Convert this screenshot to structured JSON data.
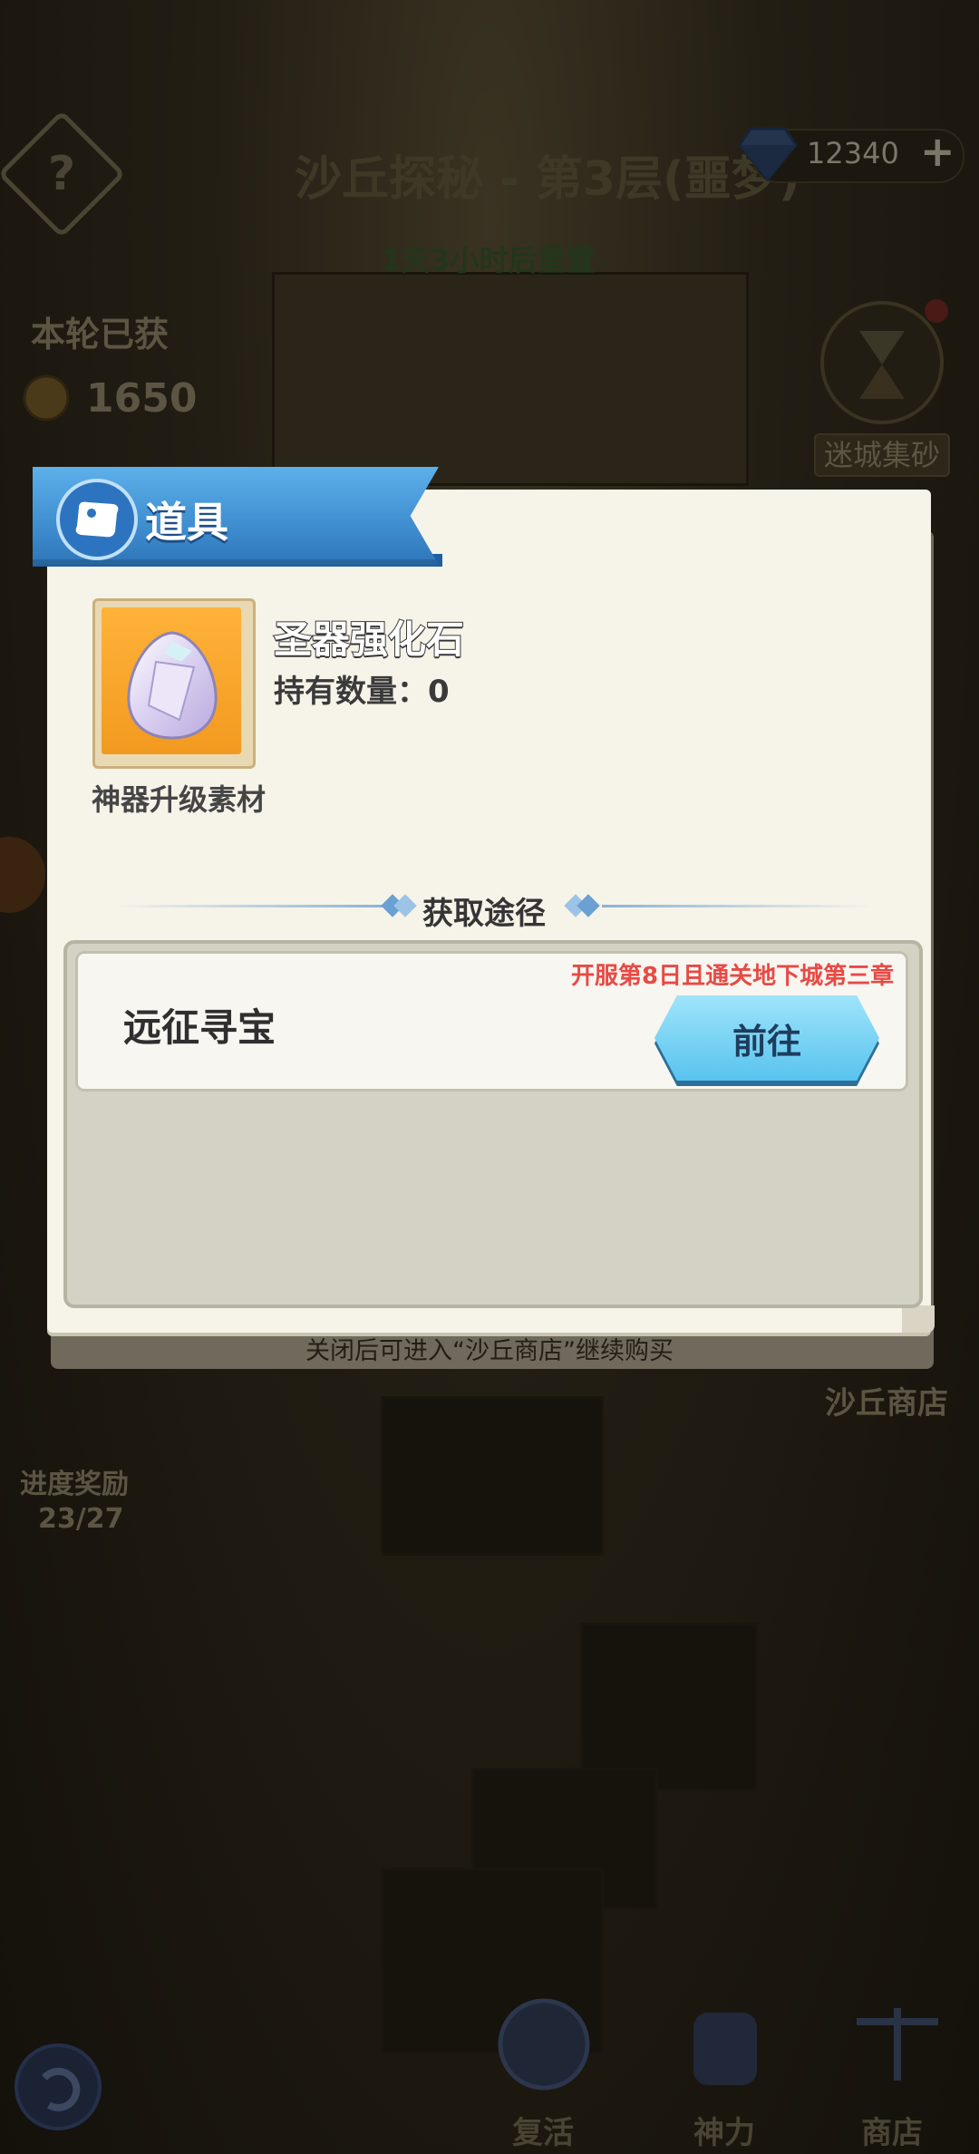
{
  "background": {
    "title": "沙丘探秘 - 第3层(噩梦)",
    "subtitle": "1天3小时后重置",
    "round_label": "本轮已获",
    "round_value": "1650",
    "gem_count": "12340",
    "gem_plus": "+",
    "help_symbol": "?",
    "maze_button": "迷城集砂",
    "shop_label": "沙丘商店",
    "progress_label": "进度奖励",
    "progress_value": "23/27",
    "nav": {
      "revive": "复活",
      "power": "神力",
      "shop": "商店"
    }
  },
  "modal": {
    "title": "道具",
    "item": {
      "name": "圣器强化石",
      "quantity": "持有数量：0",
      "description": "神器升级素材"
    },
    "section_title": "获取途径",
    "sources": [
      {
        "name": "远征寻宝",
        "condition": "开服第8日且通关地下城第三章",
        "button_label": "前往"
      }
    ],
    "close_hint": "关闭后可进入“沙丘商店”继续购买"
  },
  "colors": {
    "ribbon": "#3f8ed0",
    "condition_text": "#e84a45",
    "go_button": "#58c3ee",
    "item_bg": "#f29a1f"
  },
  "icons": [
    "help-icon",
    "gem-icon",
    "hourglass-icon",
    "scroll-icon",
    "crystal-icon",
    "back-icon",
    "revive-icon",
    "fist-icon",
    "scales-icon"
  ]
}
